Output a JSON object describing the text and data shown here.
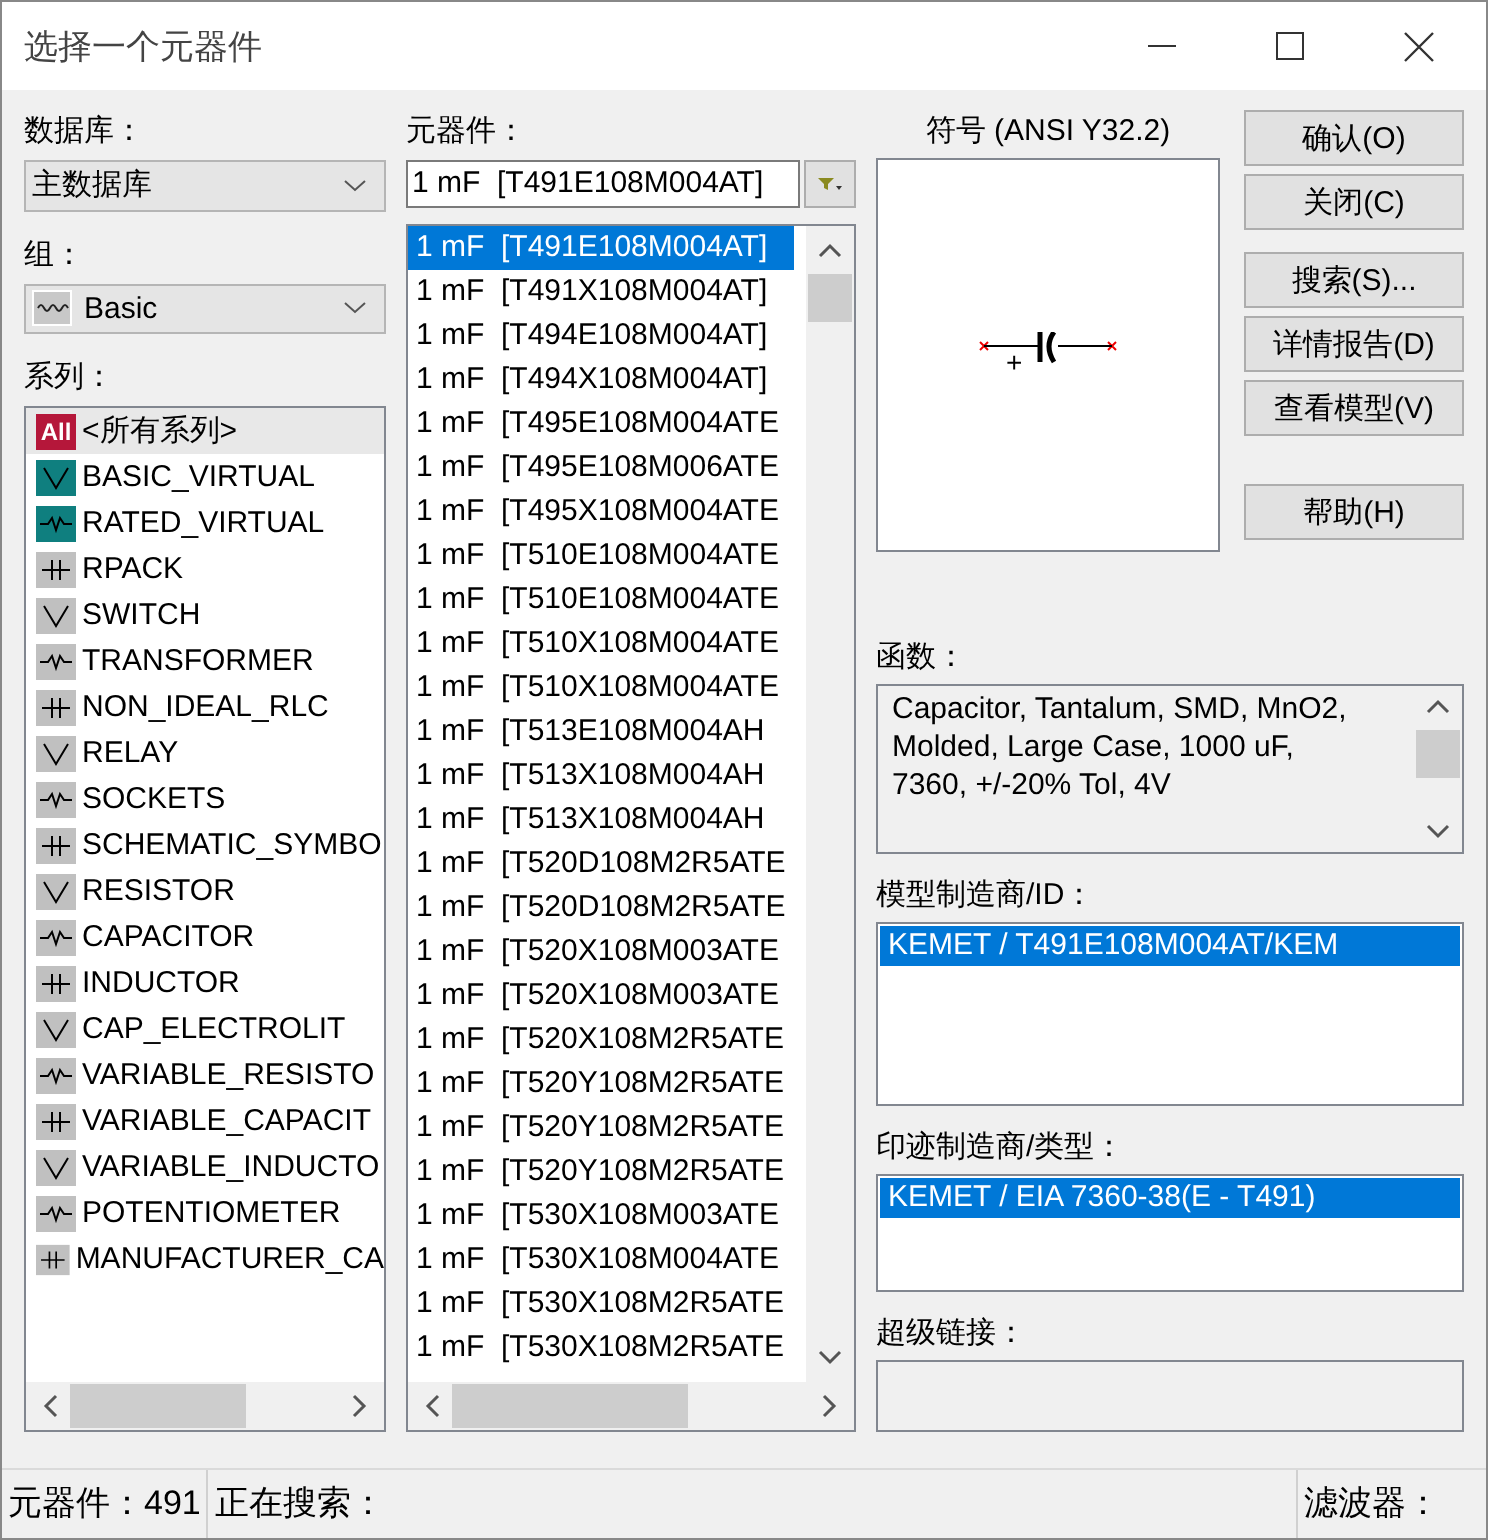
{
  "window": {
    "title": "选择一个元器件"
  },
  "database": {
    "label": "数据库：",
    "value": "主数据库"
  },
  "group": {
    "label": "组：",
    "value": "Basic"
  },
  "series": {
    "label": "系列：",
    "items": [
      {
        "badge": "All",
        "name": "<所有系列>",
        "selected": true
      },
      {
        "name": "BASIC_VIRTUAL",
        "selected": false
      },
      {
        "name": "RATED_VIRTUAL",
        "selected": false
      },
      {
        "name": "RPACK",
        "selected": false
      },
      {
        "name": "SWITCH",
        "selected": false
      },
      {
        "name": "TRANSFORMER",
        "selected": false
      },
      {
        "name": "NON_IDEAL_RLC",
        "selected": false
      },
      {
        "name": "RELAY",
        "selected": false
      },
      {
        "name": "SOCKETS",
        "selected": false
      },
      {
        "name": "SCHEMATIC_SYMBO",
        "selected": false
      },
      {
        "name": "RESISTOR",
        "selected": false
      },
      {
        "name": "CAPACITOR",
        "selected": false
      },
      {
        "name": "INDUCTOR",
        "selected": false
      },
      {
        "name": "CAP_ELECTROLIT",
        "selected": false
      },
      {
        "name": "VARIABLE_RESISTO",
        "selected": false
      },
      {
        "name": "VARIABLE_CAPACIT",
        "selected": false
      },
      {
        "name": "VARIABLE_INDUCTO",
        "selected": false
      },
      {
        "name": "POTENTIOMETER",
        "selected": false
      },
      {
        "name": "MANUFACTURER_CA",
        "selected": false
      }
    ]
  },
  "component": {
    "label": "元器件：",
    "value": "1 mF  [T491E108M004AT]",
    "items": [
      {
        "text": "1 mF  [T491E108M004AT]",
        "selected": true
      },
      {
        "text": "1 mF  [T491X108M004AT]",
        "selected": false
      },
      {
        "text": "1 mF  [T494E108M004AT]",
        "selected": false
      },
      {
        "text": "1 mF  [T494X108M004AT]",
        "selected": false
      },
      {
        "text": "1 mF  [T495E108M004ATE",
        "selected": false
      },
      {
        "text": "1 mF  [T495E108M006ATE",
        "selected": false
      },
      {
        "text": "1 mF  [T495X108M004ATE",
        "selected": false
      },
      {
        "text": "1 mF  [T510E108M004ATE",
        "selected": false
      },
      {
        "text": "1 mF  [T510E108M004ATE",
        "selected": false
      },
      {
        "text": "1 mF  [T510X108M004ATE",
        "selected": false
      },
      {
        "text": "1 mF  [T510X108M004ATE",
        "selected": false
      },
      {
        "text": "1 mF  [T513E108M004AH",
        "selected": false
      },
      {
        "text": "1 mF  [T513X108M004AH",
        "selected": false
      },
      {
        "text": "1 mF  [T513X108M004AH",
        "selected": false
      },
      {
        "text": "1 mF  [T520D108M2R5ATE",
        "selected": false
      },
      {
        "text": "1 mF  [T520D108M2R5ATE",
        "selected": false
      },
      {
        "text": "1 mF  [T520X108M003ATE",
        "selected": false
      },
      {
        "text": "1 mF  [T520X108M003ATE",
        "selected": false
      },
      {
        "text": "1 mF  [T520X108M2R5ATE",
        "selected": false
      },
      {
        "text": "1 mF  [T520Y108M2R5ATE",
        "selected": false
      },
      {
        "text": "1 mF  [T520Y108M2R5ATE",
        "selected": false
      },
      {
        "text": "1 mF  [T520Y108M2R5ATE",
        "selected": false
      },
      {
        "text": "1 mF  [T530X108M003ATE",
        "selected": false
      },
      {
        "text": "1 mF  [T530X108M004ATE",
        "selected": false
      },
      {
        "text": "1 mF  [T530X108M2R5ATE",
        "selected": false
      },
      {
        "text": "1 mF  [T530X108M2R5ATE",
        "selected": false
      }
    ]
  },
  "symbol": {
    "label": "符号 (ANSI Y32.2)",
    "plus": "+"
  },
  "buttons": [
    "确认(O)",
    "关闭(C)",
    "搜索(S)...",
    "详情报告(D)",
    "查看模型(V)",
    "帮助(H)"
  ],
  "function": {
    "label": "函数：",
    "lines": [
      "Capacitor, Tantalum, SMD, MnO2,",
      "Molded, Large Case, 1000 uF,",
      "7360, +/-20% Tol, 4V"
    ]
  },
  "model": {
    "label": "模型制造商/ID：",
    "items": [
      {
        "text": "KEMET / T491E108M004AT/KEM",
        "selected": true
      }
    ]
  },
  "footprint": {
    "label": "印迹制造商/类型：",
    "items": [
      {
        "text": "KEMET / EIA 7360-38(E - T491)",
        "selected": true
      }
    ]
  },
  "hyperlink": {
    "label": "超级链接："
  },
  "status_bar": {
    "count": "元器件：491",
    "searching": "正在搜索：",
    "filter": "滤波器："
  }
}
